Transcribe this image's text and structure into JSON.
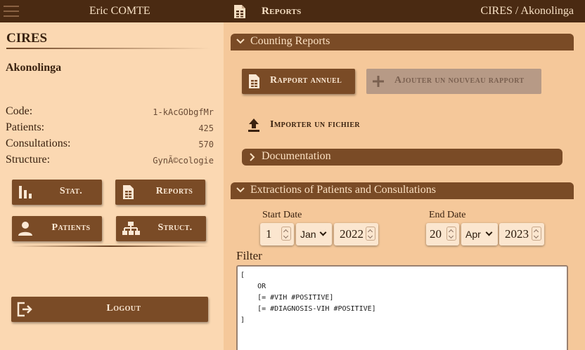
{
  "topbar": {
    "user_name": "Eric COMTE",
    "page_title": "Reports",
    "breadcrumb": "CIRES / Akonolinga"
  },
  "sidebar": {
    "org_name": "CIRES",
    "site_name": "Akonolinga",
    "info": [
      {
        "label": "Code:",
        "value": "1-kAcGObgfMr"
      },
      {
        "label": "Patients:",
        "value": "425"
      },
      {
        "label": "Consultations:",
        "value": "570"
      },
      {
        "label": "Structure:",
        "value": "GynÃ©cologie"
      }
    ],
    "buttons": {
      "stat": "Stat.",
      "reports": "Reports",
      "patients": "Patients",
      "struct": "Struct.",
      "logout": "Logout"
    }
  },
  "main": {
    "counting_reports": {
      "title": "Counting Reports",
      "annual_report_label": "Rapport annuel",
      "add_report_label": "Ajouter un nouveau rapport",
      "import_label": "Importer un fichier",
      "documentation_label": "Documentation"
    },
    "extractions": {
      "title": "Extractions of Patients and Consultations",
      "start_date_label": "Start Date",
      "start_day": "1",
      "start_month": "Jan",
      "start_year": "2022",
      "end_date_label": "End Date",
      "end_day": "20",
      "end_month": "Apr",
      "end_year": "2023",
      "filter_label": "Filter",
      "filter_text": "[\n    OR\n    [= #VIH #POSITIVE]\n    [= #DIAGNOSIS-VIH #POSITIVE]\n]"
    }
  },
  "icons": {
    "menu": "hamburger-icon",
    "reports": "report-document-icon",
    "stat": "bar-chart-icon",
    "patients": "person-icon",
    "struct": "org-structure-icon",
    "logout": "logout-icon",
    "add": "plus-icon",
    "import": "upload-icon",
    "expand": "chevron-down-icon",
    "collapse": "chevron-right-icon"
  },
  "colors": {
    "topbar": "#4a2a12",
    "button": "#7a4b26",
    "sidebar_bg": "#fbd8b2",
    "main_bg": "#f5c89a",
    "disabled": "#b79a86"
  }
}
